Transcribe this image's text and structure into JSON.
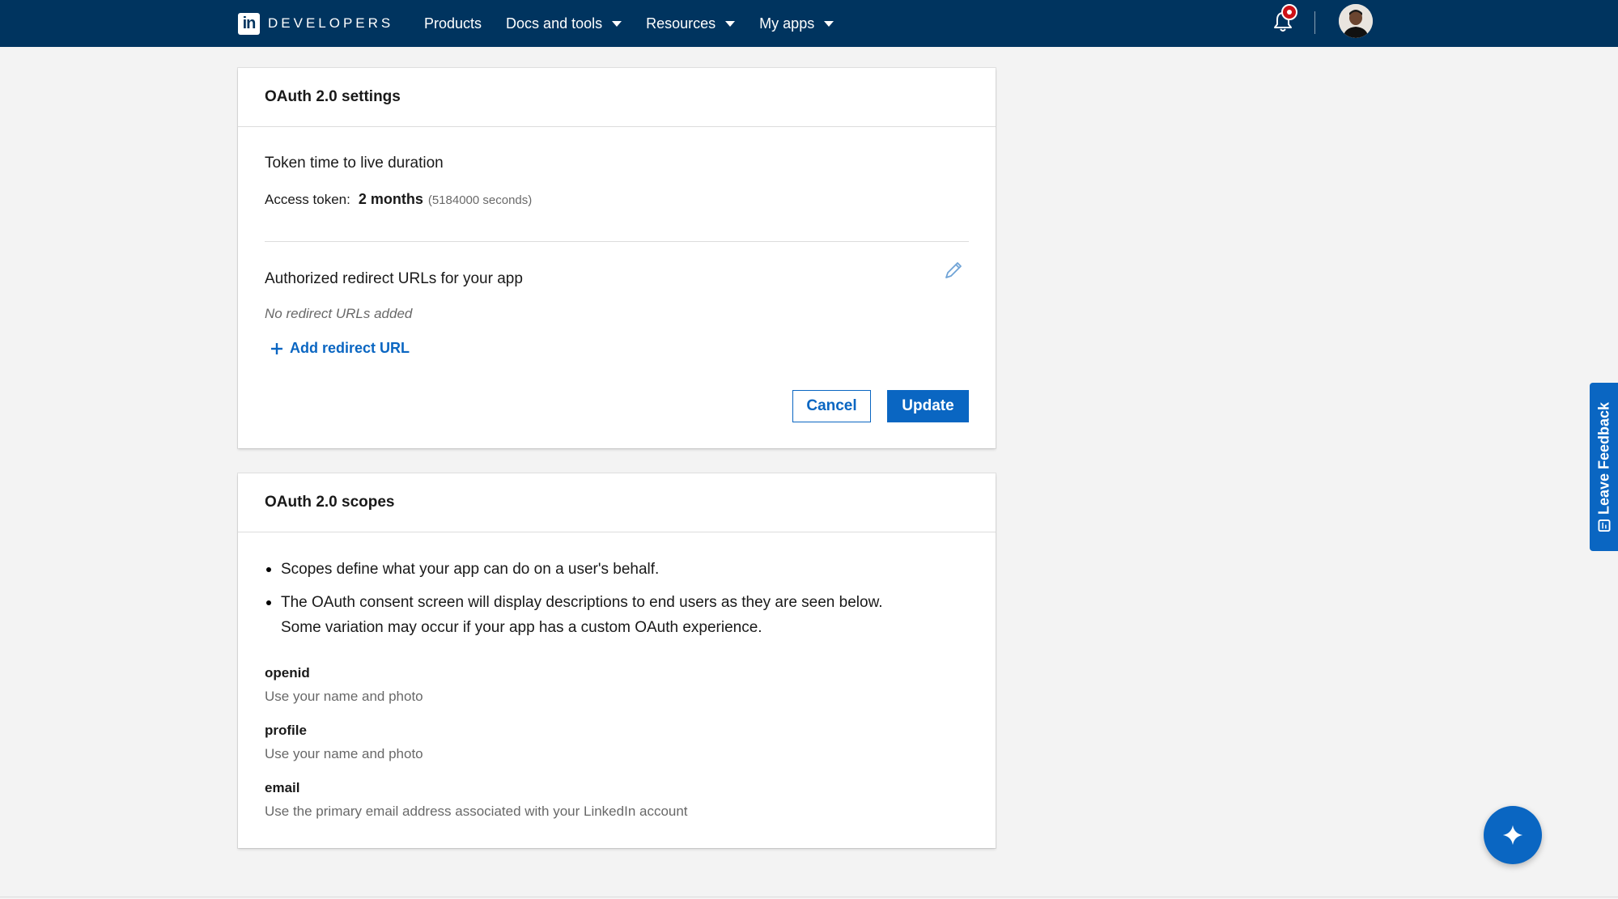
{
  "nav": {
    "brand_logo": "in",
    "brand_text": "DEVELOPERS",
    "items": [
      {
        "label": "Products",
        "has_dropdown": false
      },
      {
        "label": "Docs and tools",
        "has_dropdown": true
      },
      {
        "label": "Resources",
        "has_dropdown": true
      },
      {
        "label": "My apps",
        "has_dropdown": true
      }
    ],
    "icons": [
      "bell-icon",
      "avatar"
    ]
  },
  "oauth_settings": {
    "title": "OAuth 2.0 settings",
    "token_section_title": "Token time to live duration",
    "access_token_label": "Access token:",
    "access_token_value": "2 months",
    "access_token_seconds": "(5184000 seconds)",
    "redirect_section_title": "Authorized redirect URLs for your app",
    "no_redirect_text": "No redirect URLs added",
    "add_redirect_label": "Add redirect URL",
    "cancel_label": "Cancel",
    "update_label": "Update"
  },
  "oauth_scopes": {
    "title": "OAuth 2.0 scopes",
    "bullets": [
      "Scopes define what your app can do on a user's behalf.",
      "The OAuth consent screen will display descriptions to end users as they are seen below.",
      "Some variation may occur if your app has a custom OAuth experience."
    ],
    "scopes": [
      {
        "name": "openid",
        "description": "Use your name and photo"
      },
      {
        "name": "profile",
        "description": "Use your name and photo"
      },
      {
        "name": "email",
        "description": "Use the primary email address associated with your LinkedIn account"
      }
    ]
  },
  "feedback": {
    "label": "Leave Feedback"
  },
  "colors": {
    "nav_bg": "#00345f",
    "accent": "#0a66c2",
    "badge": "#cc1016",
    "page_bg": "#f3f3f3"
  }
}
